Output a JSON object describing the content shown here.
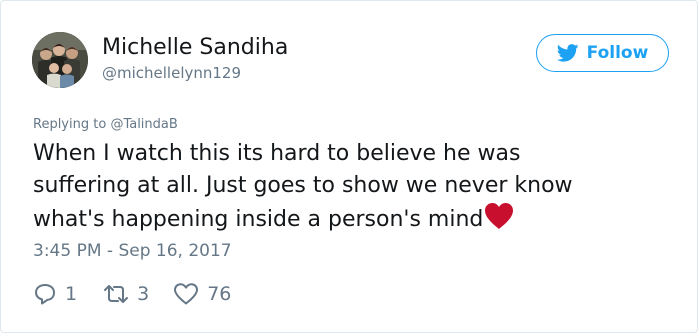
{
  "user": {
    "display_name": "Michelle Sandiha",
    "screen_name": "@michellelynn129",
    "avatar_icon": "group-photo-avatar"
  },
  "follow_button": {
    "label": "Follow",
    "icon": "twitter-bird-icon",
    "color": "#1da1f2"
  },
  "reply_context": {
    "prefix": "Replying to ",
    "mention": "@TalindaB"
  },
  "tweet": {
    "lines": [
      "When I watch this its hard to believe he was",
      "suffering at all. Just goes to show we never know",
      "what's happening inside a person's mind"
    ],
    "emoji": "red-heart-icon",
    "emoji_color": "#c8102e",
    "timestamp": "3:45 PM - Sep 16, 2017"
  },
  "actions": {
    "replies": "1",
    "retweets": "3",
    "likes": "76"
  },
  "colors": {
    "text": "#14171a",
    "secondary": "#657786",
    "border": "#e1e8ed"
  }
}
